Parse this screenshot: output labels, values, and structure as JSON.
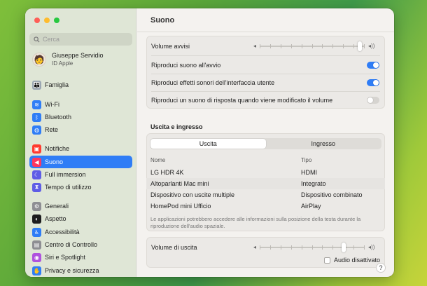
{
  "window": {
    "title": "Suono"
  },
  "sidebar": {
    "search_placeholder": "Cerca",
    "user": {
      "name": "Giuseppe Servidio",
      "subtitle": "ID Apple"
    },
    "items": [
      {
        "label": "Famiglia",
        "icon": "family-icon",
        "color": "#9aa6b2",
        "glyph": "👪"
      },
      {
        "label": "Wi-Fi",
        "icon": "wifi-icon",
        "color": "#2f7df6",
        "glyph": "≋"
      },
      {
        "label": "Bluetooth",
        "icon": "bluetooth-icon",
        "color": "#2f7df6",
        "glyph": "ᛒ"
      },
      {
        "label": "Rete",
        "icon": "network-icon",
        "color": "#2f7df6",
        "glyph": "◍"
      },
      {
        "label": "Notifiche",
        "icon": "notifications-icon",
        "color": "#ff3b30",
        "glyph": "▣"
      },
      {
        "label": "Suono",
        "icon": "sound-icon",
        "color": "#ff375f",
        "glyph": "◀"
      },
      {
        "label": "Full immersion",
        "icon": "focus-icon",
        "color": "#5e5ce6",
        "glyph": "☾"
      },
      {
        "label": "Tempo di utilizzo",
        "icon": "screen-time-icon",
        "color": "#5e5ce6",
        "glyph": "⧗"
      },
      {
        "label": "Generali",
        "icon": "gear-icon",
        "color": "#8e8e93",
        "glyph": "⚙"
      },
      {
        "label": "Aspetto",
        "icon": "appearance-icon",
        "color": "#1c1c1e",
        "glyph": "◐"
      },
      {
        "label": "Accessibilità",
        "icon": "accessibility-icon",
        "color": "#2f7df6",
        "glyph": "♿"
      },
      {
        "label": "Centro di Controllo",
        "icon": "control-center-icon",
        "color": "#8e8e93",
        "glyph": "▤"
      },
      {
        "label": "Siri e Spotlight",
        "icon": "siri-icon",
        "color": "#af52de",
        "glyph": "◉"
      },
      {
        "label": "Privacy e sicurezza",
        "icon": "privacy-icon",
        "color": "#2f7df6",
        "glyph": "✋"
      }
    ],
    "active": "Suono"
  },
  "main": {
    "title": "Suono",
    "alerts": {
      "volume_label": "Volume avvisi",
      "volume_level": 0.95,
      "toggles": [
        {
          "label": "Riproduci suono all'avvio",
          "on": true
        },
        {
          "label": "Riproduci effetti sonori dell'interfaccia utente",
          "on": true
        },
        {
          "label": "Riproduci un suono di risposta quando viene modificato il volume",
          "on": false
        }
      ]
    },
    "section_title": "Uscita e ingresso",
    "segments": {
      "output": "Uscita",
      "input": "Ingresso",
      "active": "Uscita"
    },
    "table": {
      "headers": {
        "name": "Nome",
        "type": "Tipo"
      },
      "rows": [
        {
          "name": "LG HDR 4K",
          "type": "HDMI",
          "selected": false
        },
        {
          "name": "Altoparlanti Mac mini",
          "type": "Integrato",
          "selected": true
        },
        {
          "name": "Dispositivo con uscite multiple",
          "type": "Dispositivo combinato",
          "selected": false
        },
        {
          "name": "HomePod mini Ufficio",
          "type": "AirPlay",
          "selected": false
        }
      ]
    },
    "note": "Le applicazioni potrebbero accedere alle informazioni sulla posizione della testa durante la riproduzione dell'audio spaziale.",
    "output_volume": {
      "label": "Volume di uscita",
      "level": 0.8
    },
    "mute_label": "Audio disattivato",
    "mute_checked": false,
    "help": "?"
  },
  "colors": {
    "accent": "#2f7df6",
    "sidebar": "#dfe6d6"
  }
}
